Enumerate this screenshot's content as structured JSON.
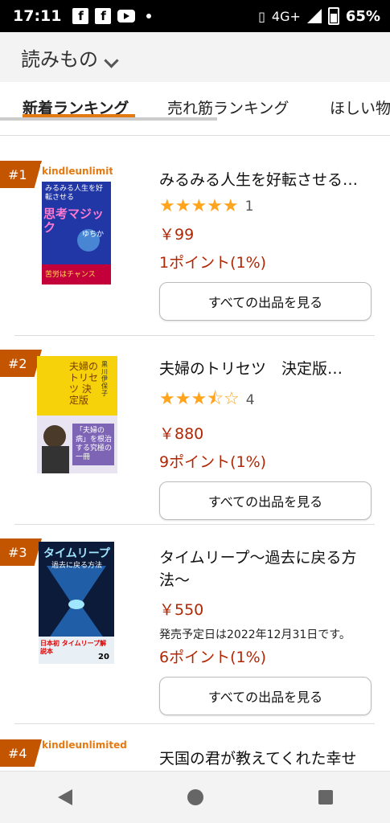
{
  "status_bar": {
    "time": "17:11",
    "network": "4G+",
    "battery": "65%"
  },
  "header": {
    "title": "読みもの"
  },
  "tabs": [
    {
      "label": "新着ランキング",
      "active": true
    },
    {
      "label": "売れ筋ランキング",
      "active": false
    },
    {
      "label": "ほしい物",
      "active": false
    }
  ],
  "items": [
    {
      "rank": "#1",
      "kindle_unlimited": "kindleunlimited",
      "title": "みるみる人生を好転させる…",
      "rating": 5,
      "stars": "★★★★★",
      "review_count": "1",
      "price": "￥99",
      "points": "1ポイント(1%)",
      "button": "すべての出品を見る",
      "cover": {
        "top": "みるみる人生を好転させる",
        "main": "思考マジック",
        "author": "ゆちか",
        "band": "苦労はチャンス"
      }
    },
    {
      "rank": "#2",
      "title": "夫婦のトリセツ　決定版…",
      "rating": 3.5,
      "stars": "★★★⯪☆",
      "review_count": "4",
      "price": "￥880",
      "points": "9ポイント(1%)",
      "button": "すべての出品を見る",
      "cover": {
        "main": "夫婦のトリセツ 決定版",
        "author": "黒川伊保子",
        "band": "「夫婦の病」を根治する究極の一冊"
      }
    },
    {
      "rank": "#3",
      "title": "タイムリープ〜過去に戻る方法〜",
      "price": "￥550",
      "release": "発売予定日は2022年12月31日です。",
      "points": "6ポイント(1%)",
      "button": "すべての出品を見る",
      "cover": {
        "main": "タイムリープ",
        "sub": "過去に戻る方法",
        "band": "日本初 タイムリープ解説本",
        "num": "20"
      }
    },
    {
      "rank": "#4",
      "kindle_unlimited": "kindleunlimited",
      "title": "天国の君が教えてくれた幸せ"
    }
  ],
  "colors": {
    "accent": "#e47911",
    "price": "#b12704",
    "rank": "#c45500",
    "star": "#ffa41c"
  },
  "icons": [
    "facebook-icon",
    "facebook-icon",
    "youtube-icon",
    "vibrate-icon",
    "signal-icon",
    "battery-icon",
    "back-icon",
    "home-icon",
    "recents-icon"
  ]
}
